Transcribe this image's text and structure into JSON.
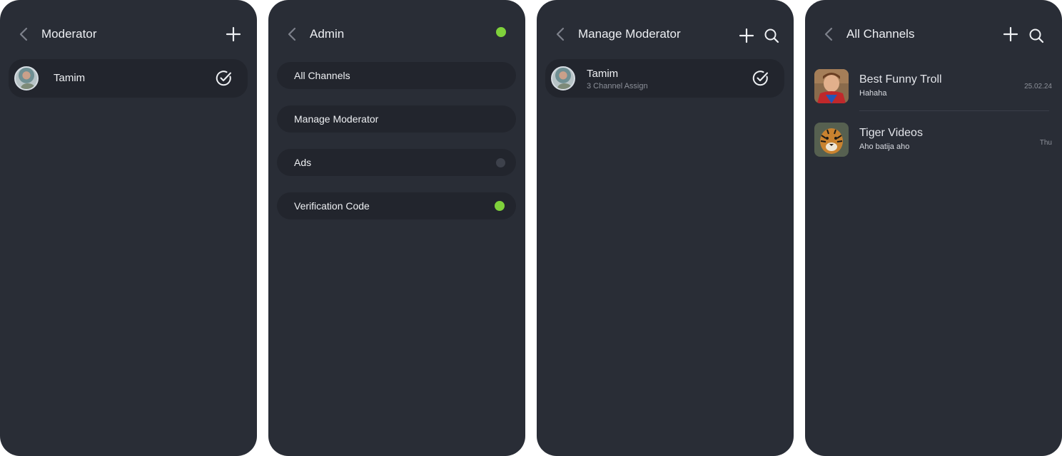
{
  "screens": {
    "moderator": {
      "title": "Moderator",
      "rows": [
        {
          "name": "Tamim"
        }
      ]
    },
    "admin": {
      "title": "Admin",
      "items": [
        {
          "label": "All Channels"
        },
        {
          "label": "Manage Moderator"
        },
        {
          "label": "Ads",
          "toggle": "off"
        },
        {
          "label": "Verification Code",
          "toggle": "on"
        }
      ]
    },
    "manage_moderator": {
      "title": "Manage Moderator",
      "rows": [
        {
          "name": "Tamim",
          "subtitle": "3 Channel Assign"
        }
      ]
    },
    "all_channels": {
      "title": "All Channels",
      "channels": [
        {
          "name": "Best Funny Troll",
          "last_message": "Hahaha",
          "date": "25.02.24"
        },
        {
          "name": "Tiger Videos",
          "last_message": "Aho batija aho",
          "date": "Thu"
        }
      ]
    }
  },
  "icons": {
    "back": "chevron-left-icon",
    "add": "plus-icon",
    "search": "search-icon",
    "check": "check-circle-icon"
  },
  "colors": {
    "background": "#292d36",
    "card": "#22252d",
    "status_on": "#7fd13b",
    "status_off": "#3d414b",
    "text": "#eceef2",
    "muted": "#8c9099"
  }
}
